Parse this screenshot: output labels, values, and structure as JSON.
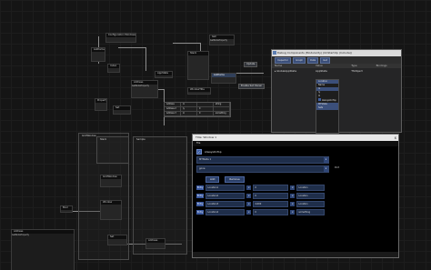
{
  "graph": {
    "nodes": {
      "n1_title": "Configuration Windows",
      "n2_title": "ListItems",
      "n3_title": "Get",
      "n3_pin": "GetNodeProperty",
      "n4_title": "AppState",
      "n5_title": "Address",
      "n5_pin": "GetNodeProperty",
      "n6_title": "Stack",
      "n7_title": "WindowTitle",
      "n8_title": "ListItems",
      "n9_title": "Index",
      "n10_title": "Property",
      "n11_title": "GridWindow",
      "n12_title": "Window",
      "n13_title": "Set",
      "n14_title": "Bool"
    },
    "buttons": {
      "update": "Update",
      "enable": "Enable Set Owner",
      "b1": "Add",
      "b2": "Remove"
    },
    "small_table": {
      "rows": [
        [
          "Address",
          "ix",
          "",
          "string"
        ],
        [
          "Address 2",
          "iy",
          "0",
          ""
        ],
        [
          "Address 3",
          "iz",
          "0",
          "something"
        ]
      ]
    },
    "groups": {
      "g1": "GridWindow",
      "g2": "Stack",
      "g3": "Sample"
    },
    "bottom_panel": {
      "title": "Address",
      "pin": "GetNodeProperty"
    }
  },
  "debugger": {
    "title": "Debug Components (Modularity) (OnStartUp (Include))",
    "tools": [
      "Inspector",
      "Graph",
      "Data",
      "Get"
    ],
    "columns": [
      "Name",
      "Value",
      "Type",
      "Bindings"
    ],
    "rows": [
      {
        "name": "GlobalAppState",
        "value": "AppState",
        "type": "TSObject",
        "bindings": ""
      }
    ],
    "inspect_items": [
      "Location",
      "Name",
      "Ix",
      "Iy",
      "Iz",
      "AlwaysOnTop",
      "MTState",
      "Sets"
    ],
    "toggle_label": "AlwaysOnTop",
    "dropdown_value": "MTState"
  },
  "property_window": {
    "title": "Title: Window 1",
    "close": "x",
    "menu": "File",
    "always_on_top_label": "AlwaysOnTop",
    "field1": "MTState 1",
    "field2": "gone",
    "field2_suffix": "Port",
    "btn_add": "Add",
    "btn_remove": "Remove",
    "rows": [
      {
        "tag": "Entry",
        "name": "Location1",
        "num": "0",
        "text": "Location"
      },
      {
        "tag": "Entry",
        "name": "Location2",
        "num": "0",
        "text": "Location"
      },
      {
        "tag": "Entry",
        "name": "Location3",
        "num": "4,000",
        "text": "Location"
      },
      {
        "tag": "Entry",
        "name": "Location4",
        "num": "0",
        "text": "something"
      }
    ]
  }
}
